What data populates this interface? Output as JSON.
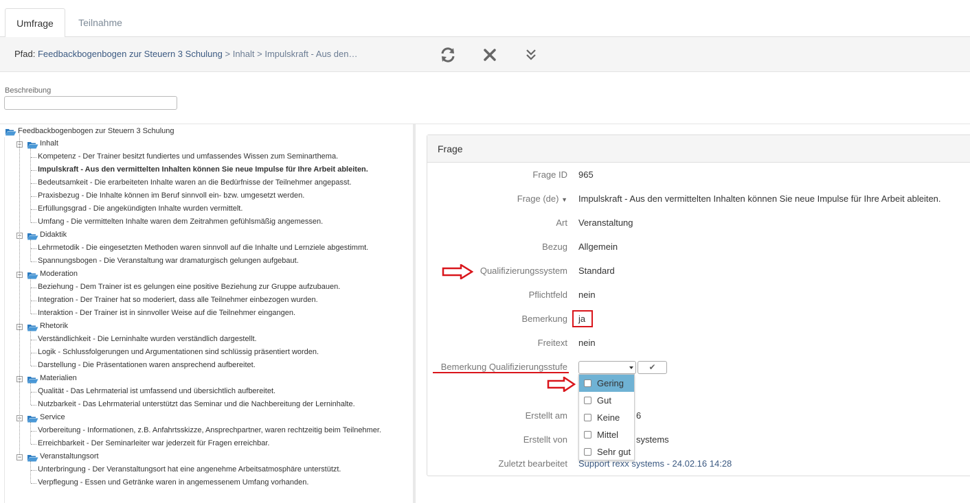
{
  "tabs": [
    {
      "label": "Umfrage",
      "active": true
    },
    {
      "label": "Teilnahme",
      "active": false
    }
  ],
  "path": {
    "label": "Pfad:",
    "root": "Feedbackbogenbogen zur Steuern 3 Schulung",
    "separator": ">",
    "crumbs": [
      "Inhalt",
      "Impulskraft - Aus den…"
    ]
  },
  "toolbar": {
    "refresh_icon": "refresh-icon",
    "close_icon": "close-icon",
    "expand_icon": "double-chevron-down-icon"
  },
  "beschreibung": {
    "label": "Beschreibung",
    "value": ""
  },
  "tree": {
    "root": "Feedbackbogenbogen zur Steuern 3 Schulung",
    "groups": [
      {
        "name": "Inhalt",
        "items": [
          "Kompetenz - Der Trainer besitzt fundiertes und umfassendes Wissen zum Seminarthema.",
          "Impulskraft - Aus den vermittelten Inhalten können Sie neue Impulse für Ihre Arbeit ableiten.",
          "Bedeutsamkeit - Die erarbeiteten Inhalte waren an die Bedürfnisse der Teilnehmer angepasst.",
          "Praxisbezug - Die Inhalte können im Beruf sinnvoll ein- bzw. umgesetzt werden.",
          "Erfüllungsgrad - Die angekündigten Inhalte wurden vermittelt.",
          "Umfang - Die vermittelten Inhalte waren dem Zeitrahmen gefühlsmäßig angemessen."
        ]
      },
      {
        "name": "Didaktik",
        "items": [
          "Lehrmetodik - Die eingesetzten Methoden waren sinnvoll auf die Inhalte und Lernziele abgestimmt.",
          "Spannungsbogen - Die Veranstaltung war dramaturgisch gelungen aufgebaut."
        ]
      },
      {
        "name": "Moderation",
        "items": [
          "Beziehung - Dem Trainer ist es gelungen eine positive Beziehung zur Gruppe aufzubauen.",
          "Integration - Der Trainer hat so moderiert, dass alle Teilnehmer einbezogen wurden.",
          "Interaktion - Der Trainer ist in sinnvoller Weise auf die Teilnehmer eingangen."
        ]
      },
      {
        "name": "Rhetorik",
        "items": [
          "Verständlichkeit - Die Lerninhalte wurden verständlich dargestellt.",
          "Logik - Schlussfolgerungen und Argumentationen sind schlüssig präsentiert worden.",
          "Darstellung - Die Präsentationen waren ansprechend aufbereitet."
        ]
      },
      {
        "name": "Materialien",
        "items": [
          "Qualität - Das Lehrmaterial ist umfassend und übersichtlich aufbereitet.",
          "Nutzbarkeit - Das Lehrmaterial unterstützt das Seminar und die Nachbereitung der Lerninhalte."
        ]
      },
      {
        "name": "Service",
        "items": [
          "Vorbereitung - Informationen, z.B. Anfahrtsskizze, Ansprechpartner, waren rechtzeitig beim Teilnehmer.",
          "Erreichbarkeit - Der Seminarleiter war jederzeit für Fragen erreichbar."
        ]
      },
      {
        "name": "Veranstaltungsort",
        "items": [
          "Unterbringung - Der Veranstaltungsort hat eine angenehme Arbeitsatmosphäre unterstützt.",
          "Verpflegung - Essen und Getränke waren in angemessenem Umfang vorhanden."
        ]
      }
    ]
  },
  "panel": {
    "title": "Frage",
    "fields": {
      "frage_id": {
        "label": "Frage ID",
        "value": "965"
      },
      "frage_de": {
        "label": "Frage (de)",
        "value": "Impulskraft - Aus den vermittelten Inhalten können Sie neue Impulse für Ihre Arbeit ableiten."
      },
      "art": {
        "label": "Art",
        "value": "Veranstaltung"
      },
      "bezug": {
        "label": "Bezug",
        "value": "Allgemein"
      },
      "qualifizierungssystem": {
        "label": "Qualifizierungssystem",
        "value": "Standard"
      },
      "pflichtfeld": {
        "label": "Pflichtfeld",
        "value": "nein"
      },
      "bemerkung": {
        "label": "Bemerkung",
        "value": "ja"
      },
      "freitext": {
        "label": "Freitext",
        "value": "nein"
      },
      "bemerkung_stufe": {
        "label": "Bemerkung Qualifizierungsstufe",
        "value": ""
      },
      "erstellt_am": {
        "label": "Erstellt am",
        "value": "6"
      },
      "erstellt_von": {
        "label": "Erstellt von",
        "value": "systems"
      },
      "zuletzt": {
        "label": "Zuletzt bearbeitet",
        "value": "Support rexx systems - 24.02.16 14:28"
      }
    },
    "dropdown_options": [
      "Gering",
      "Gut",
      "Keine",
      "Mittel",
      "Sehr gut"
    ],
    "highlighted_option": "Gering",
    "ok_icon": "checkmark-icon"
  },
  "annotation_color": "#d9151b"
}
